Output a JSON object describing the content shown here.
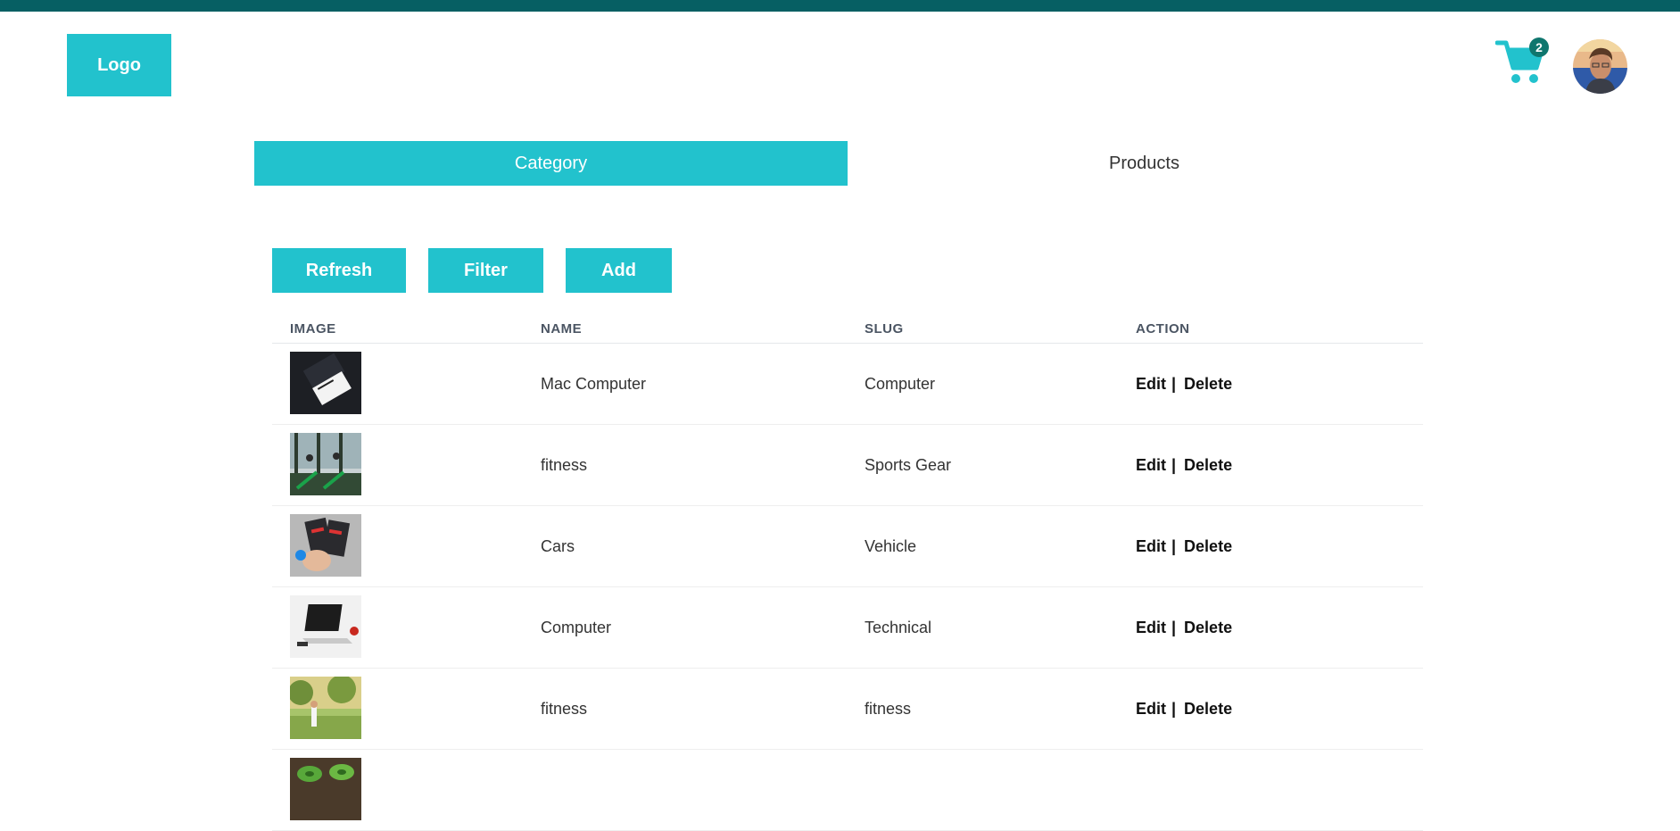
{
  "header": {
    "logo_label": "Logo",
    "cart_count": "2",
    "cart_icon": "shopping-cart-icon",
    "avatar_icon": "user-avatar",
    "topbar_color": "#065f63",
    "accent_color": "#22c2cd"
  },
  "tabs": [
    {
      "label": "Category",
      "active": true
    },
    {
      "label": "Products",
      "active": false
    }
  ],
  "toolbar": {
    "refresh_label": "Refresh",
    "filter_label": "Filter",
    "add_label": "Add"
  },
  "table": {
    "headers": {
      "image": "IMAGE",
      "name": "NAME",
      "slug": "SLUG",
      "action": "ACTION"
    },
    "rows": [
      {
        "name": "Mac Computer",
        "slug": "Computer",
        "edit": "Edit",
        "delete": "Delete",
        "image": "business-cards-image"
      },
      {
        "name": "fitness",
        "slug": "Sports Gear",
        "edit": "Edit",
        "delete": "Delete",
        "image": "treadmill-gym-image"
      },
      {
        "name": "Cars",
        "slug": "Vehicle",
        "edit": "Edit",
        "delete": "Delete",
        "image": "hand-holding-cards-image"
      },
      {
        "name": "Computer",
        "slug": "Technical",
        "edit": "Edit",
        "delete": "Delete",
        "image": "laptop-desk-image"
      },
      {
        "name": "fitness",
        "slug": "fitness",
        "edit": "Edit",
        "delete": "Delete",
        "image": "person-in-park-image"
      },
      {
        "name": "",
        "slug": "",
        "edit": "",
        "delete": "",
        "image": "green-fruit-image"
      }
    ],
    "separator": "|"
  }
}
